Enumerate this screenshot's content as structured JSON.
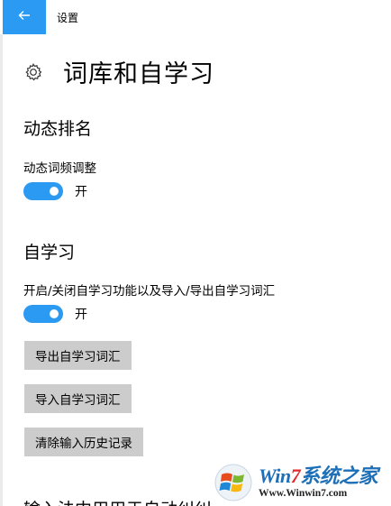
{
  "titlebar": {
    "back_icon": "back-arrow-icon",
    "app_title": "设置"
  },
  "page": {
    "icon": "gear-icon",
    "title": "词库和自学习"
  },
  "sections": [
    {
      "title": "动态排名",
      "setting_label": "动态词频调整",
      "toggle_on": true,
      "toggle_state": "开"
    },
    {
      "title": "自学习",
      "setting_label": "开启/关闭自学习功能以及导入/导出自学习词汇",
      "toggle_on": true,
      "toggle_state": "开"
    }
  ],
  "buttons": {
    "export": "导出自学习词汇",
    "import": "导入自学习词汇",
    "clear": "清除输入历史记录"
  },
  "cut_off_heading": "输入法中用用于自动纠纠错",
  "watermark": {
    "brand_win": "Win",
    "brand_seven": "7",
    "brand_rest": "系统之家",
    "url": "Www.Winwin7.com"
  },
  "colors": {
    "accent": "#2b9af3",
    "button_bg": "#cccccc"
  }
}
